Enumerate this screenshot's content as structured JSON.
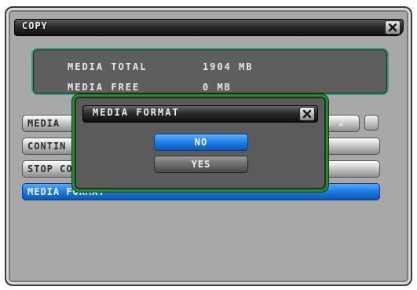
{
  "window": {
    "title": "COPY",
    "close_icon": "close-icon"
  },
  "info": {
    "media_total_label": "MEDIA TOTAL",
    "media_total_value": "1904 MB",
    "media_free_label": "MEDIA FREE",
    "media_free_value": "0 MB"
  },
  "rows": [
    {
      "label": "MEDIA",
      "suffix": "B 2"
    },
    {
      "label": "CONTIN"
    },
    {
      "label": "STOP CO"
    },
    {
      "label": "MEDIA FORMAT"
    }
  ],
  "dialog": {
    "title": "MEDIA FORMAT",
    "no_label": "NO",
    "yes_label": "YES",
    "border_color": "#1f8f2a"
  },
  "colors": {
    "selected": "#1a7be0",
    "panel_border": "#2fa37a"
  }
}
